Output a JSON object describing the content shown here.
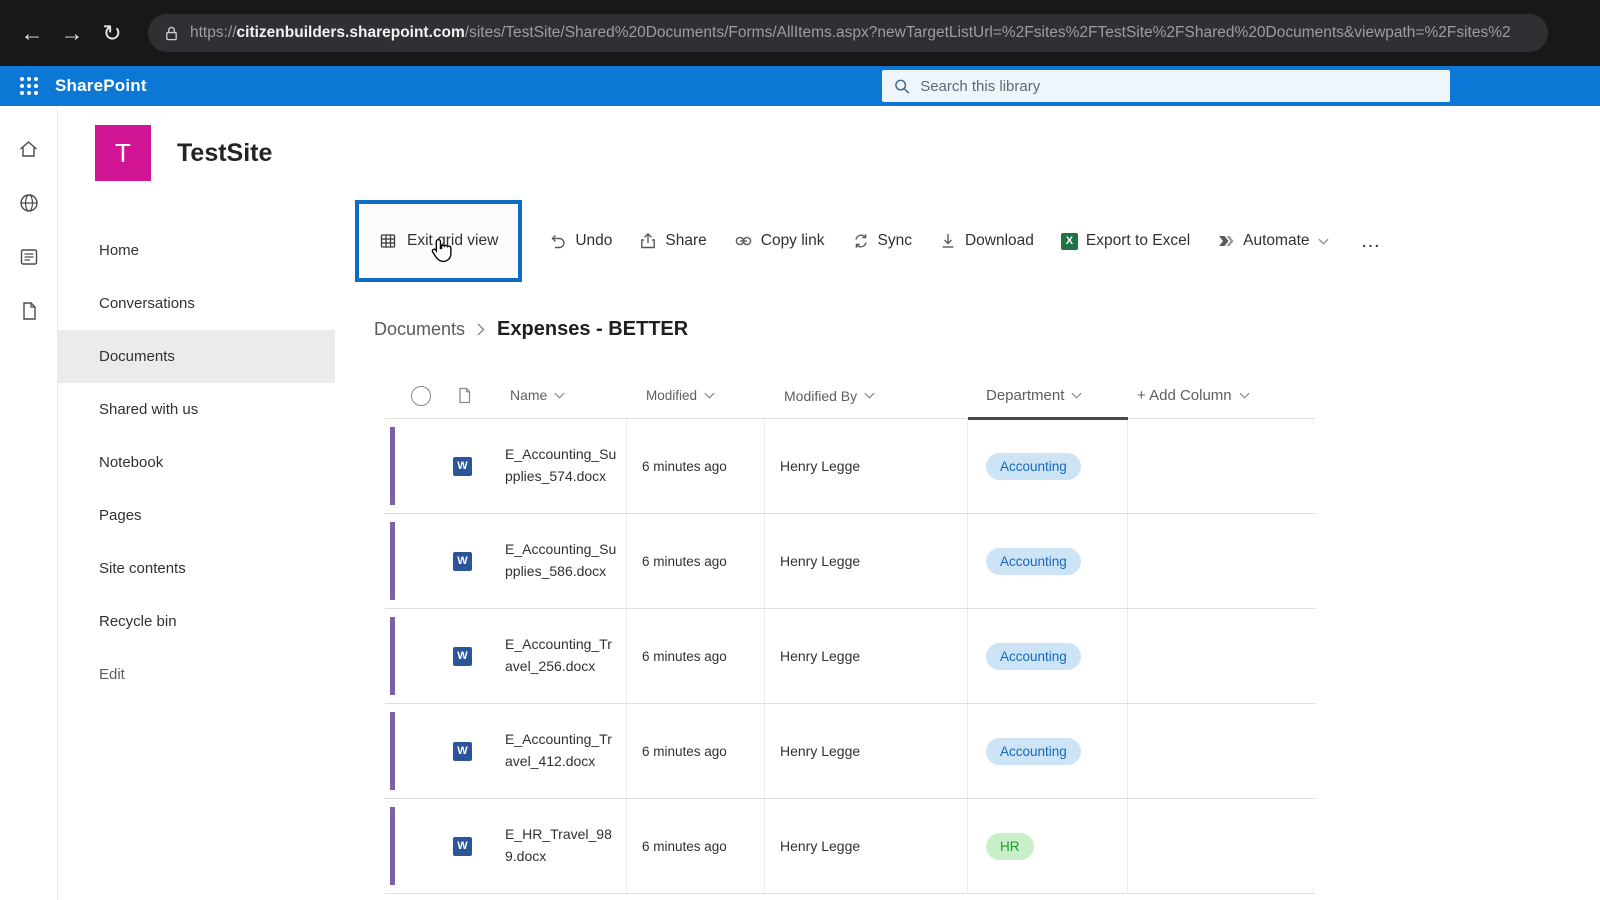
{
  "browser": {
    "url_scheme": "https://",
    "url_domain": "citizenbuilders.sharepoint.com",
    "url_path": "/sites/TestSite/Shared%20Documents/Forms/AllItems.aspx?newTargetListUrl=%2Fsites%2FTestSite%2FShared%20Documents&viewpath=%2Fsites%2"
  },
  "suite_bar": {
    "brand": "SharePoint",
    "search_placeholder": "Search this library"
  },
  "site": {
    "logo_letter": "T",
    "title": "TestSite"
  },
  "sidebar": {
    "items": [
      {
        "label": "Home"
      },
      {
        "label": "Conversations"
      },
      {
        "label": "Documents"
      },
      {
        "label": "Shared with us"
      },
      {
        "label": "Notebook"
      },
      {
        "label": "Pages"
      },
      {
        "label": "Site contents"
      },
      {
        "label": "Recycle bin"
      },
      {
        "label": "Edit"
      }
    ]
  },
  "toolbar": {
    "exit_grid_view_label": "Exit grid view",
    "items": [
      "Undo",
      "Share",
      "Copy link",
      "Sync",
      "Download",
      "Export to Excel",
      "Automate"
    ],
    "overflow_label": "…"
  },
  "breadcrumb": {
    "parent": "Documents",
    "current": "Expenses - BETTER"
  },
  "table": {
    "columns": [
      "Name",
      "Modified",
      "Modified By",
      "Department",
      "+ Add Column"
    ],
    "rows": [
      {
        "name": "E_Accounting_Supplies_574.docx",
        "modified": "6 minutes ago",
        "modified_by": "Henry Legge",
        "department": "Accounting"
      },
      {
        "name": "E_Accounting_Supplies_586.docx",
        "modified": "6 minutes ago",
        "modified_by": "Henry Legge",
        "department": "Accounting"
      },
      {
        "name": "E_Accounting_Travel_256.docx",
        "modified": "6 minutes ago",
        "modified_by": "Henry Legge",
        "department": "Accounting"
      },
      {
        "name": "E_Accounting_Travel_412.docx",
        "modified": "6 minutes ago",
        "modified_by": "Henry Legge",
        "department": "Accounting"
      },
      {
        "name": "E_HR_Travel_989.docx",
        "modified": "6 minutes ago",
        "modified_by": "Henry Legge",
        "department": "HR"
      }
    ]
  },
  "icons": {
    "back": "←",
    "forward": "→",
    "reload": "↻",
    "word_letter": "W",
    "excel_letter": "X"
  },
  "colors": {
    "suite_bar": "#0c77d4",
    "highlight_border": "#0e6cc4",
    "row_edit_bar": "#7b61a6",
    "pill_accounting_bg": "#cde3f6",
    "pill_accounting_text": "#1569bd",
    "pill_hr_bg": "#c8efc8",
    "pill_hr_text": "#1e9e2e",
    "site_logo": "#d01493",
    "nav_selected_bg": "#edebe9"
  }
}
